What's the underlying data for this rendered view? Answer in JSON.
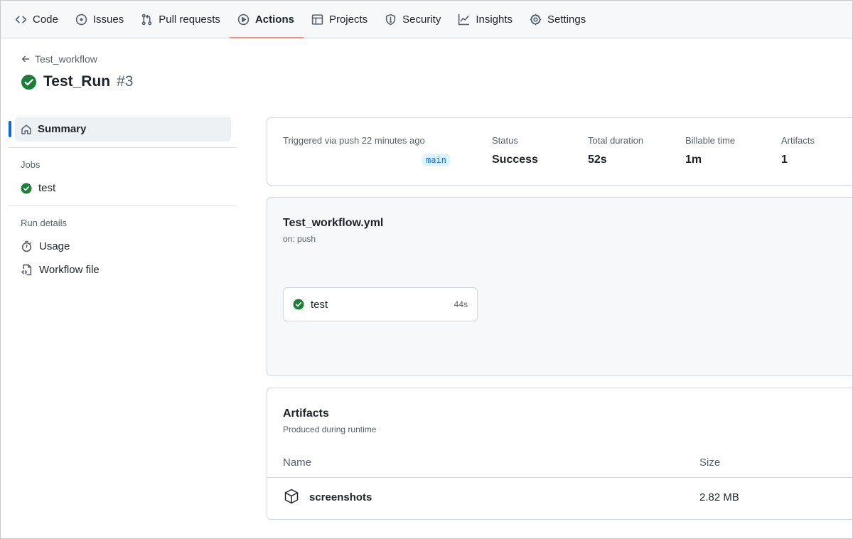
{
  "nav": {
    "tabs": [
      {
        "label": "Code",
        "icon": "code-icon"
      },
      {
        "label": "Issues",
        "icon": "issue-icon"
      },
      {
        "label": "Pull requests",
        "icon": "pull-request-icon"
      },
      {
        "label": "Actions",
        "icon": "play-icon",
        "active": true
      },
      {
        "label": "Projects",
        "icon": "table-icon"
      },
      {
        "label": "Security",
        "icon": "shield-icon"
      },
      {
        "label": "Insights",
        "icon": "graph-icon"
      },
      {
        "label": "Settings",
        "icon": "gear-icon"
      }
    ],
    "accent_color": "#fd8c73"
  },
  "header": {
    "back_label": "Test_workflow",
    "run_name": "Test_Run",
    "run_number": "#3",
    "status_color": "#1a7f37"
  },
  "sidebar": {
    "summary_label": "Summary",
    "jobs_heading": "Jobs",
    "jobs": [
      {
        "label": "test"
      }
    ],
    "run_details_heading": "Run details",
    "details": [
      {
        "label": "Usage",
        "icon": "stopwatch-icon"
      },
      {
        "label": "Workflow file",
        "icon": "file-code-icon"
      }
    ]
  },
  "summary": {
    "triggered_label": "Triggered via push 22 minutes ago",
    "branch": "main",
    "status_label": "Status",
    "status_value": "Success",
    "duration_label": "Total duration",
    "duration_value": "52s",
    "billable_label": "Billable time",
    "billable_value": "1m",
    "artifacts_label": "Artifacts",
    "artifacts_value": "1"
  },
  "workflow": {
    "file_name": "Test_workflow.yml",
    "trigger": "on: push",
    "job": {
      "label": "test",
      "duration": "44s"
    }
  },
  "artifacts": {
    "title": "Artifacts",
    "subtitle": "Produced during runtime",
    "col_name": "Name",
    "col_size": "Size",
    "rows": [
      {
        "name": "screenshots",
        "size": "2.82 MB",
        "icon": "package-icon"
      }
    ]
  }
}
